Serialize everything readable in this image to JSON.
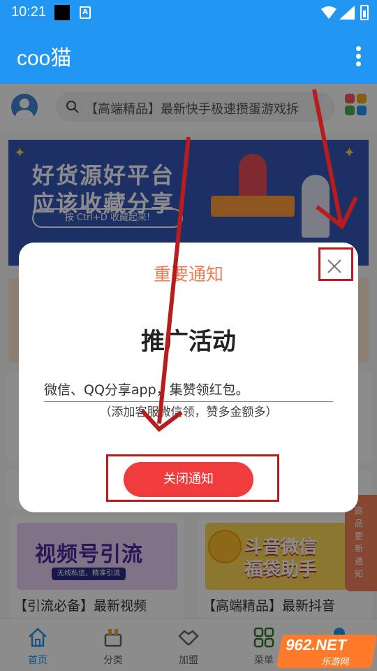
{
  "status_bar": {
    "time": "10:21",
    "a_icon": "A"
  },
  "app_bar": {
    "title": "coo猫"
  },
  "search": {
    "text": "【高端精品】最新快手极速攒蛋游戏拆"
  },
  "banner": {
    "line1": "好货源好平台",
    "line2": "应该收藏分享",
    "pill": "按 Ctrl+D 收藏起来!"
  },
  "cards": [
    {
      "image_title": "视频号引流",
      "image_sub": "无线私信，精准引流",
      "caption": "【引流必备】最新视频"
    },
    {
      "image_title": "斗音微信",
      "image_title2": "福袋助手",
      "caption": "【高端精品】最新抖音"
    }
  ],
  "side_tab": {
    "text": "商品更新通知"
  },
  "tabbar": {
    "items": [
      {
        "label": "首页",
        "icon": "home-icon",
        "active": true
      },
      {
        "label": "分类",
        "icon": "category-icon",
        "active": false
      },
      {
        "label": "加盟",
        "icon": "handshake-icon",
        "active": false
      },
      {
        "label": "菜单",
        "icon": "menu-grid-icon",
        "active": false
      },
      {
        "label": "",
        "icon": "user-icon",
        "active": false
      }
    ]
  },
  "dialog": {
    "title": "重要通知",
    "heading": "推广活动",
    "line1": "微信、QQ分享app，集赞领红包。",
    "line2": "（添加客服微信领，赞多金额多）",
    "button": "关闭通知"
  },
  "watermark": {
    "main": "962.NET",
    "sub": "乐游网"
  },
  "colors": {
    "primary": "#2196f3",
    "dialog_title": "#f27a50",
    "button": "#f03c3c",
    "annotation": "#b81c1c"
  }
}
